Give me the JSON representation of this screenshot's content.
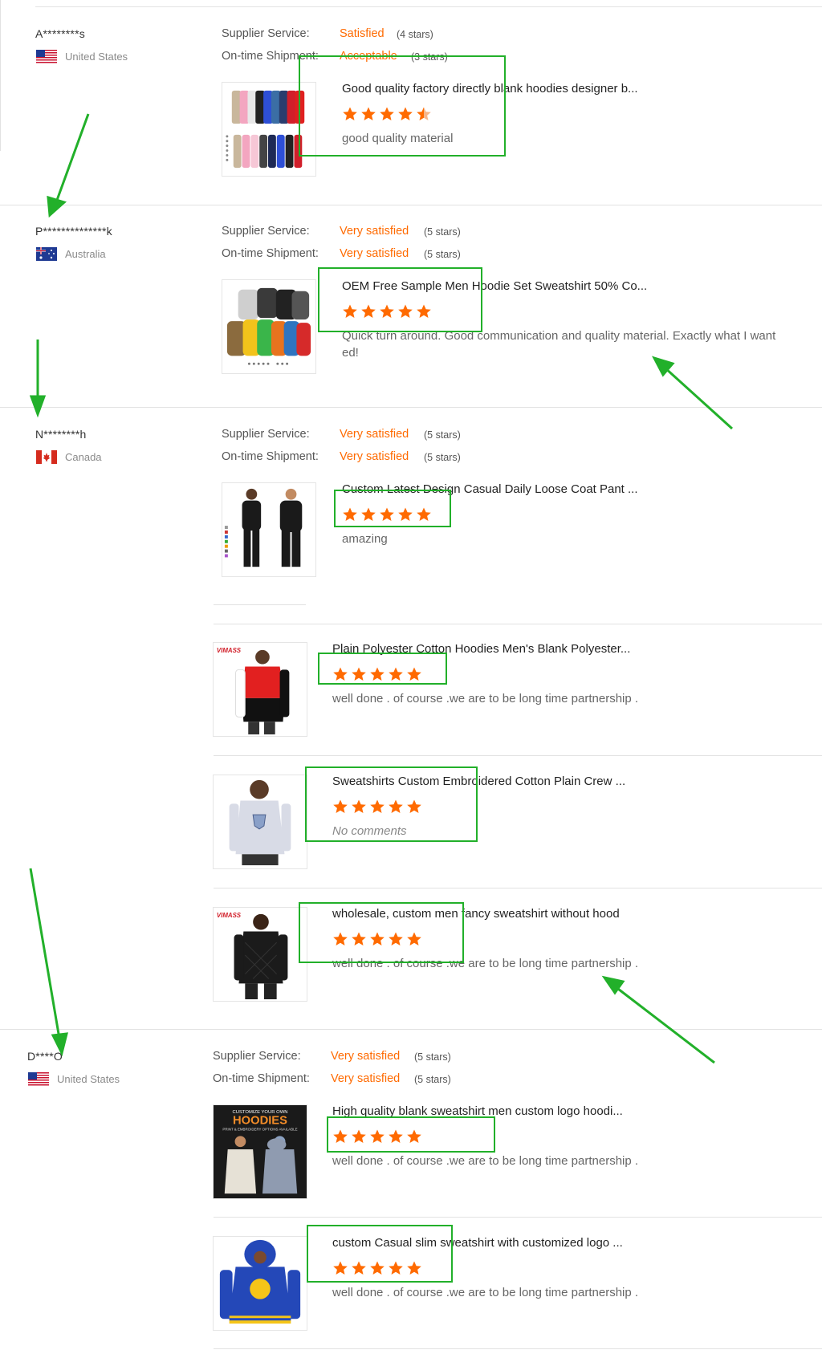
{
  "labels": {
    "supplier_service": "Supplier Service:",
    "on_time_shipment": "On-time Shipment:"
  },
  "colors": {
    "accent": "#ff6a00",
    "annotation": "#22b02a",
    "divider": "#e2e2e2"
  },
  "reviews": [
    {
      "buyer": "A********s",
      "country": "United States",
      "flag_icon": "us-flag-icon",
      "supplier_service": {
        "value": "Satisfied",
        "stars": "(4 stars)"
      },
      "on_time_shipment": {
        "value": "Acceptable",
        "stars": "(3 stars)"
      },
      "products": [
        {
          "title": "Good quality factory directly blank hoodies designer b...",
          "rating": 4.5,
          "comment": "good quality material"
        }
      ]
    },
    {
      "buyer": "P**************k",
      "country": "Australia",
      "flag_icon": "australia-flag-icon",
      "supplier_service": {
        "value": "Very satisfied",
        "stars": "(5 stars)"
      },
      "on_time_shipment": {
        "value": "Very satisfied",
        "stars": "(5 stars)"
      },
      "products": [
        {
          "title": "OEM Free Sample Men Hoodie Set Sweatshirt 50% Co...",
          "rating": 5,
          "comment_line1": "Quick turn around. Good communication and quality material. Exactly what I want",
          "comment_line2": "ed!"
        }
      ]
    },
    {
      "buyer": "N********h",
      "country": "Canada",
      "flag_icon": "canada-flag-icon",
      "supplier_service": {
        "value": "Very satisfied",
        "stars": "(5 stars)"
      },
      "on_time_shipment": {
        "value": "Very satisfied",
        "stars": "(5 stars)"
      },
      "products": [
        {
          "title": "Custom Latest Design Casual Daily Loose Coat Pant ...",
          "rating": 5,
          "comment": "amazing"
        },
        {
          "title": "Plain Polyester Cotton Hoodies Men's Blank Polyester...",
          "rating": 5,
          "comment": "well done . of course .we are to be  long time partnership ."
        },
        {
          "title": "Sweatshirts Custom Embroidered Cotton Plain Crew ...",
          "rating": 5,
          "comment": "No comments"
        },
        {
          "title": "wholesale, custom men fancy sweatshirt without hood",
          "rating": 5,
          "comment": "well done . of course .we are to be  long time partnership ."
        }
      ]
    },
    {
      "buyer": "D****O",
      "country": "United States",
      "flag_icon": "us-flag-icon",
      "supplier_service": {
        "value": "Very satisfied",
        "stars": "(5 stars)"
      },
      "on_time_shipment": {
        "value": "Very satisfied",
        "stars": "(5 stars)"
      },
      "products": [
        {
          "title": "High quality blank sweatshirt men custom logo hoodi...",
          "rating": 5,
          "comment": "well done . of course .we are to be  long time partnership ."
        },
        {
          "title": "custom Casual slim sweatshirt with customized logo ...",
          "rating": 5,
          "comment": "well done . of course .we are to be  long time partnership ."
        }
      ]
    }
  ],
  "thumbnails": {
    "vimass_brand": "VIMASS",
    "hoodies_banner_top": "CUSTOMIZE YOUR OWN",
    "hoodies_banner_main": "HOODIES",
    "hoodies_banner_sub": "PRINT & EMBROIDERY OPTIONS AVAILABLE"
  }
}
